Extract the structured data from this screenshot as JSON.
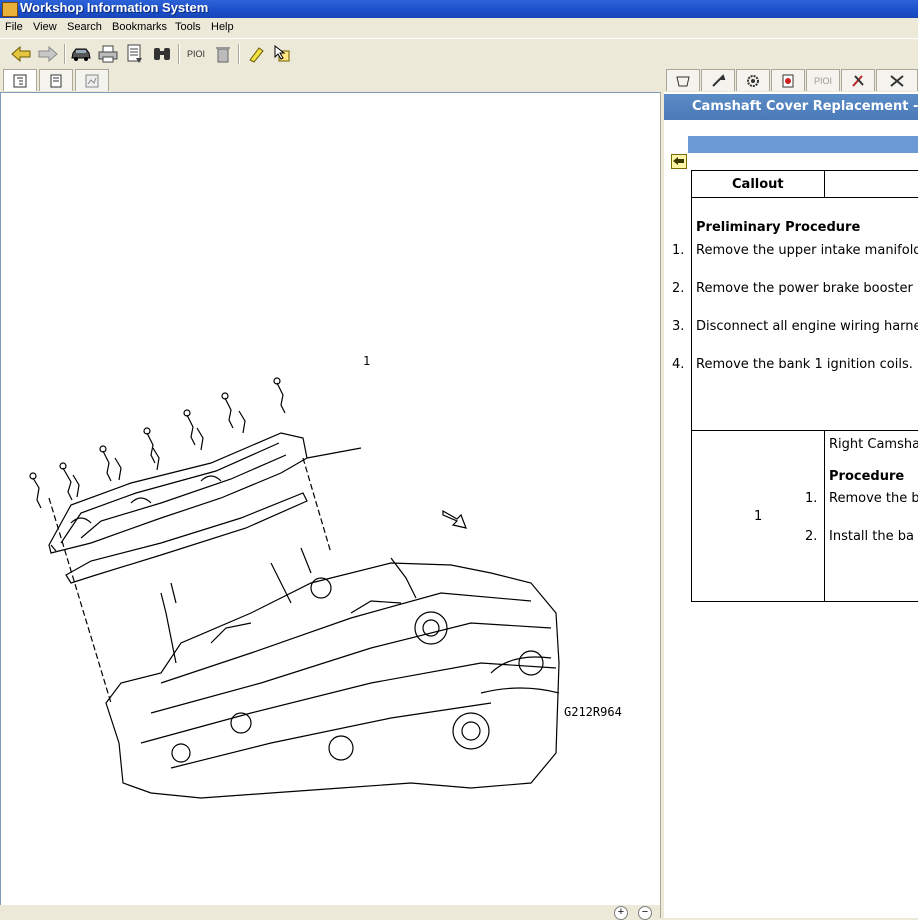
{
  "window": {
    "title": "Workshop Information System"
  },
  "menu": [
    "File",
    "View",
    "Search",
    "Bookmarks",
    "Tools",
    "Help"
  ],
  "toolbar": {
    "icons": [
      "back-arrow-icon",
      "forward-arrow-icon",
      "vehicle-icon",
      "print-icon",
      "document-icon",
      "binoculars-icon",
      "pioi-label",
      "trash-icon",
      "highlighter-icon",
      "cursor-note-icon"
    ],
    "pioi_label": "PIOI"
  },
  "right_tabs": {
    "pioi_label": "PIOI"
  },
  "drawing": {
    "callout_number": "1",
    "figure_id": "G212R964"
  },
  "document": {
    "title": "Camshaft Cover Replacement -",
    "table_header": {
      "callout": "Callout",
      "component": ""
    },
    "preliminary": {
      "heading": "Preliminary Procedure",
      "steps": [
        {
          "num": "1.",
          "text": "Remove the upper intake manifold"
        },
        {
          "num": "2.",
          "text": "Remove the power brake booster"
        },
        {
          "num": "3.",
          "text": "Disconnect all engine wiring harne"
        },
        {
          "num": "4.",
          "text": "Remove the bank 1 ignition coils."
        }
      ]
    },
    "row1": {
      "callout": "1",
      "component": "Right Camsha",
      "procedure_heading": "Procedure",
      "steps": [
        {
          "num": "1.",
          "text": "Remove the b"
        },
        {
          "num": "2.",
          "text": "Install the ba"
        }
      ]
    }
  },
  "status": {
    "zoom_in": "+",
    "zoom_out": "−"
  }
}
